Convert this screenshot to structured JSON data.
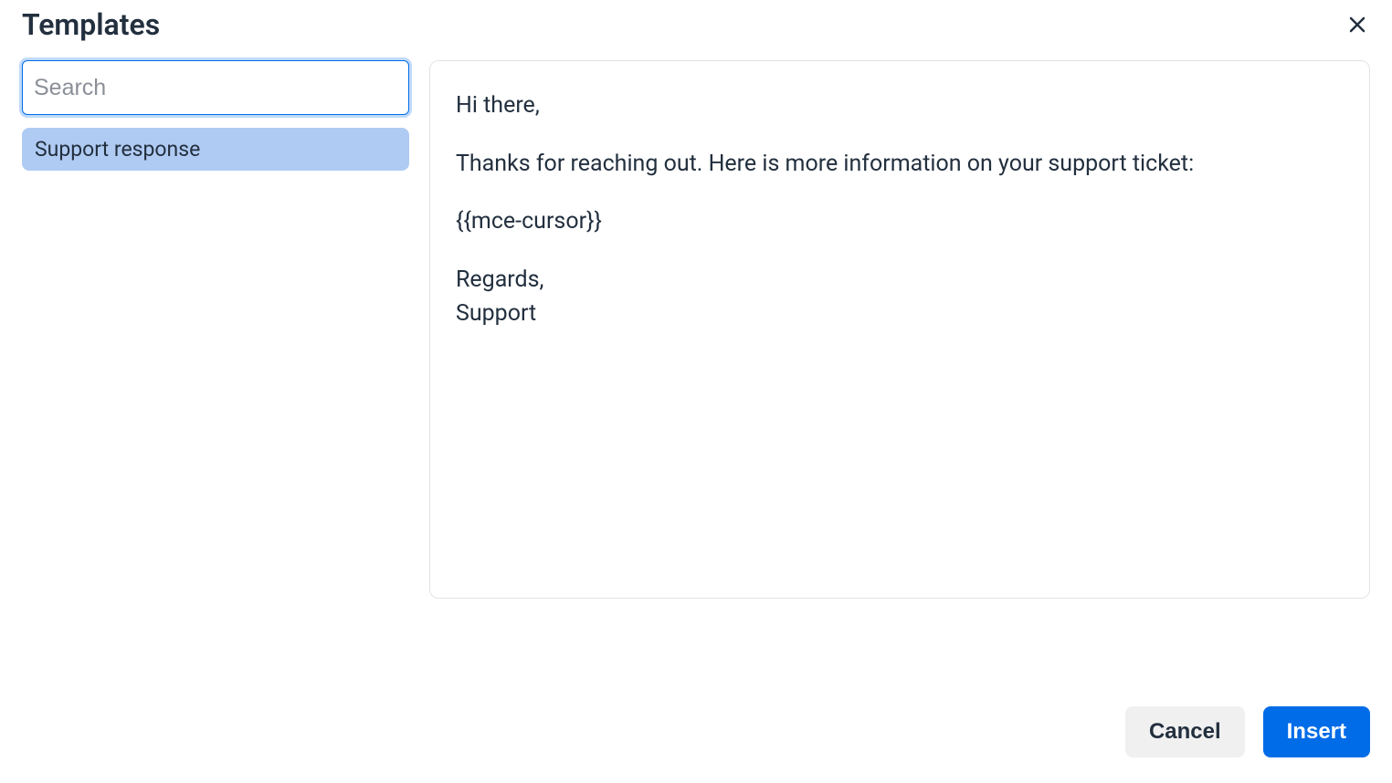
{
  "header": {
    "title": "Templates"
  },
  "search": {
    "placeholder": "Search",
    "value": ""
  },
  "templates": [
    {
      "label": "Support response",
      "selected": true
    }
  ],
  "preview": {
    "p1": "Hi there,",
    "p2": "Thanks for reaching out. Here is more information on your support ticket:",
    "p3": "{{mce-cursor}}",
    "p4_line1": "Regards,",
    "p4_line2": "Support"
  },
  "footer": {
    "cancel": "Cancel",
    "insert": "Insert"
  }
}
